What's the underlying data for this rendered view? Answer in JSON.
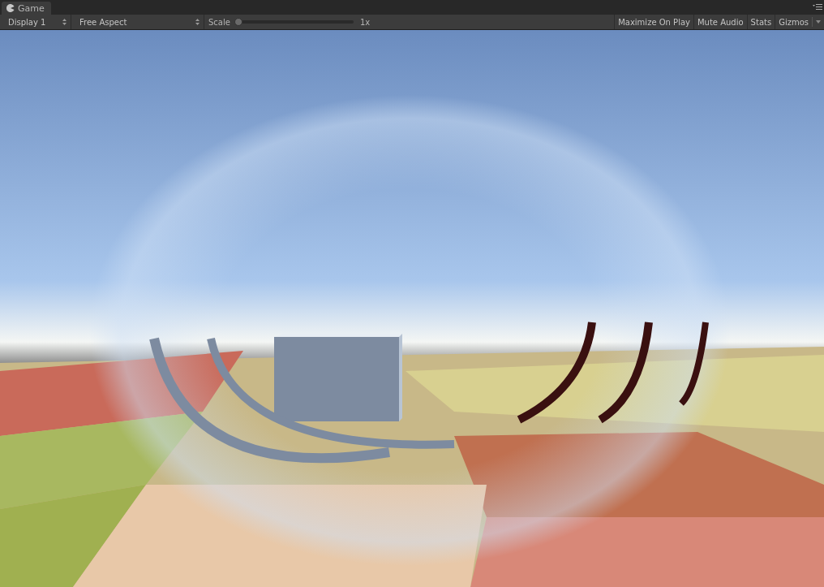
{
  "tabs": [
    {
      "label": "Game",
      "selected": true
    }
  ],
  "toolbar": {
    "display": "Display 1",
    "aspect": "Free Aspect",
    "scale": {
      "label": "Scale",
      "level": 0,
      "reading": "1x"
    },
    "toggles": [
      {
        "label": "Maximize On Play",
        "on": false
      },
      {
        "label": "Mute Audio",
        "on": false
      },
      {
        "label": "Stats",
        "on": false
      }
    ],
    "gizmos": "Gizmos"
  }
}
